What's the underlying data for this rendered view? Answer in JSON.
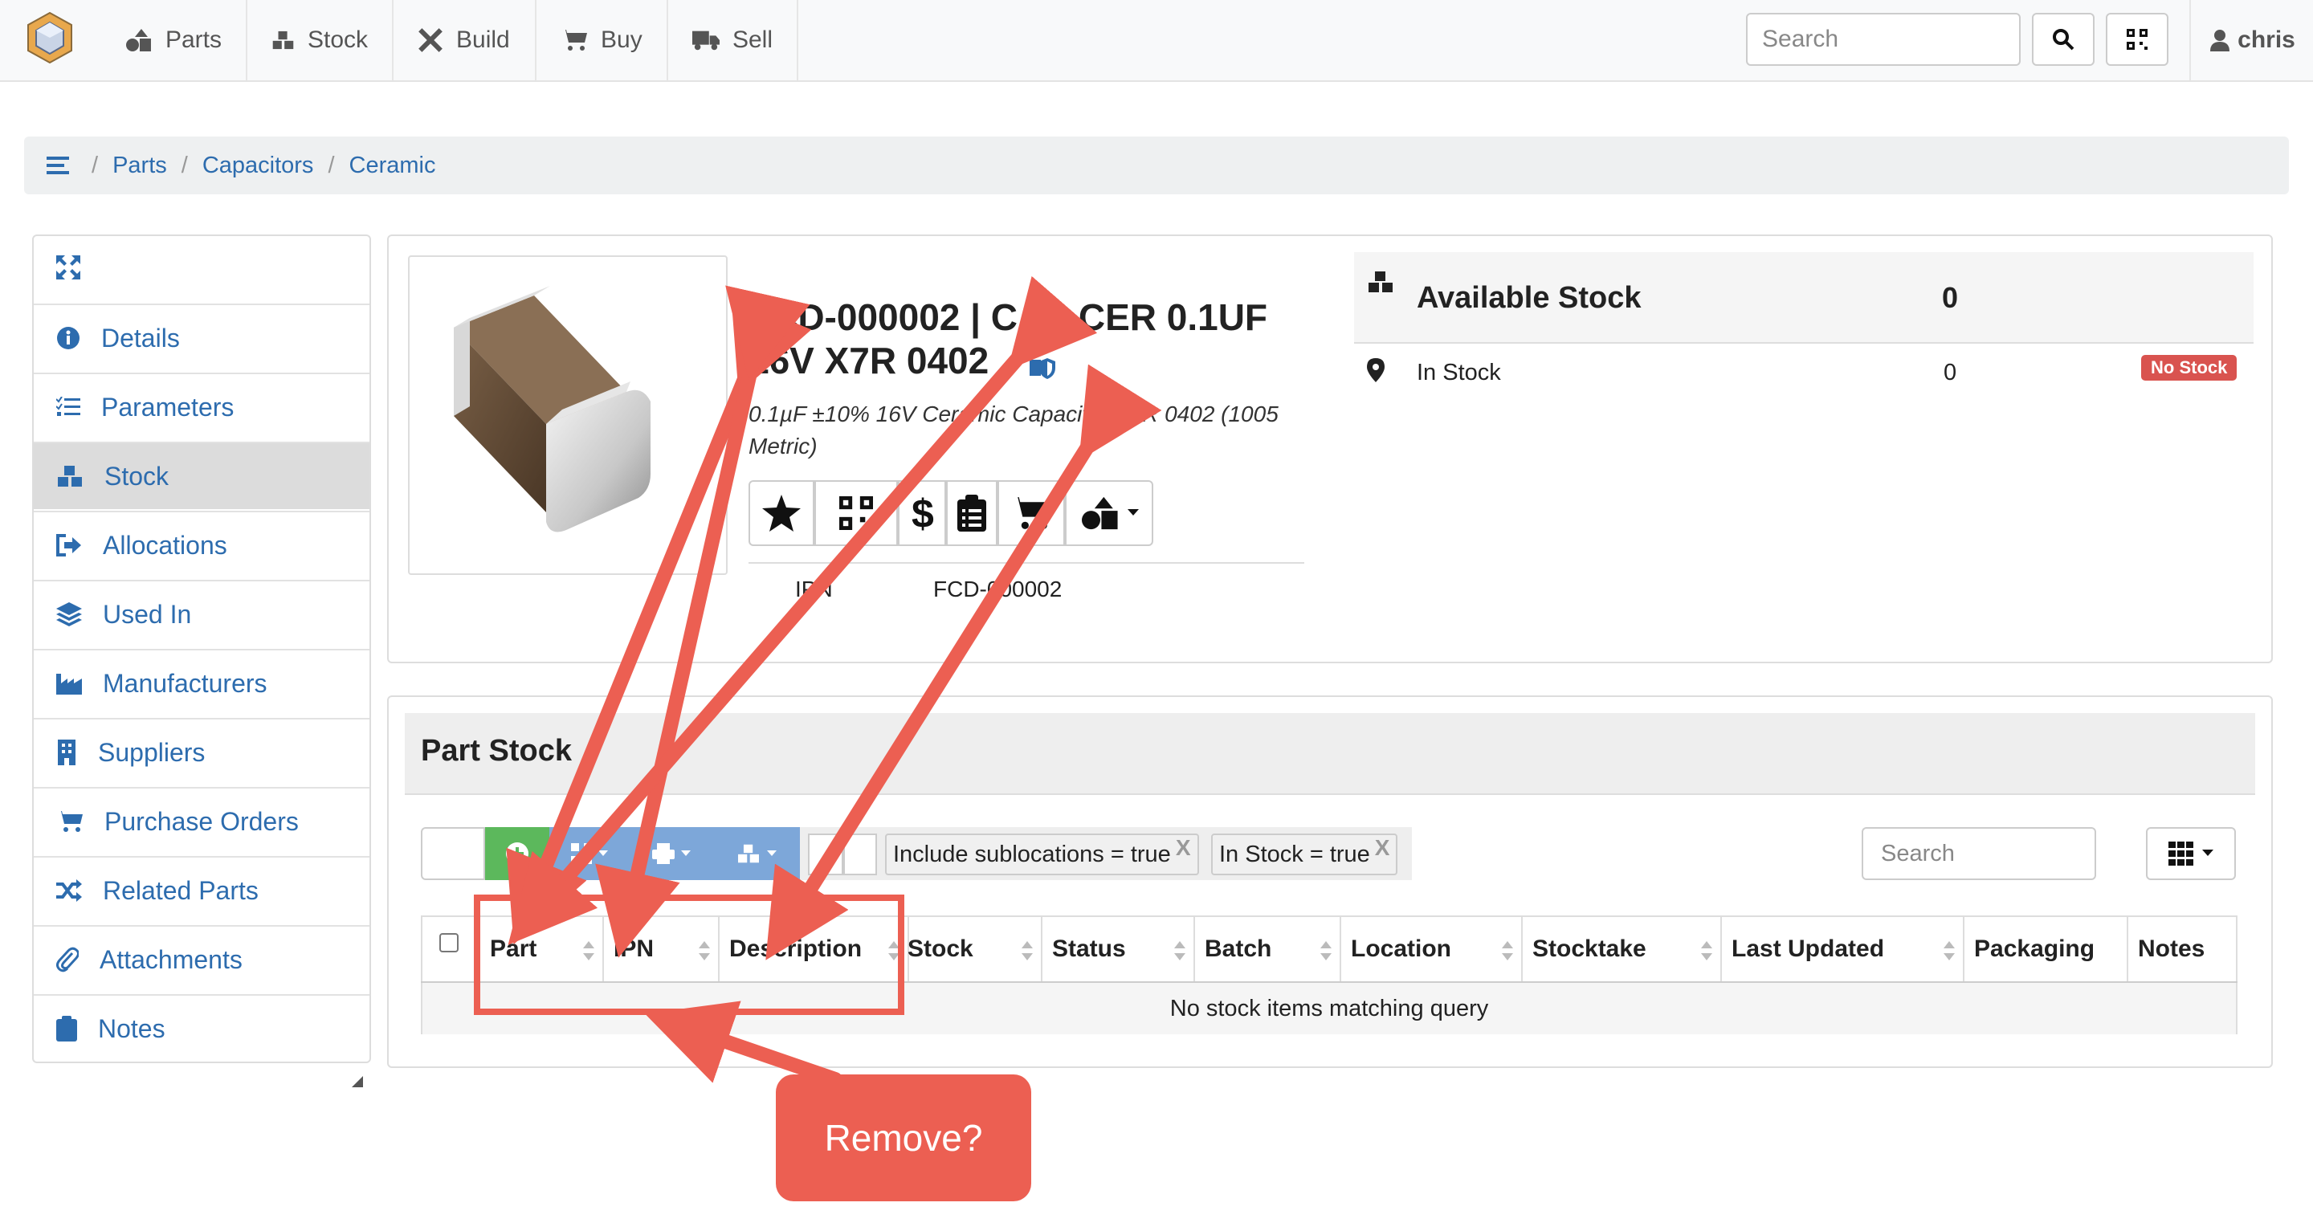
{
  "navbar": {
    "items": [
      {
        "label": "Parts",
        "icon": "shapes-icon"
      },
      {
        "label": "Stock",
        "icon": "boxes-icon"
      },
      {
        "label": "Build",
        "icon": "tools-icon"
      },
      {
        "label": "Buy",
        "icon": "cart-icon"
      },
      {
        "label": "Sell",
        "icon": "truck-icon"
      }
    ],
    "search_placeholder": "Search",
    "user": "chris"
  },
  "breadcrumb": [
    "Parts",
    "Capacitors",
    "Ceramic"
  ],
  "sidebar": {
    "items": [
      {
        "label": "Details",
        "icon": "info-icon"
      },
      {
        "label": "Parameters",
        "icon": "list-check-icon"
      },
      {
        "label": "Stock",
        "icon": "boxes-icon",
        "active": true
      },
      {
        "label": "Allocations",
        "icon": "sign-out-icon"
      },
      {
        "label": "Used In",
        "icon": "layers-icon"
      },
      {
        "label": "Manufacturers",
        "icon": "industry-icon"
      },
      {
        "label": "Suppliers",
        "icon": "building-icon"
      },
      {
        "label": "Purchase Orders",
        "icon": "cart-icon"
      },
      {
        "label": "Related Parts",
        "icon": "random-icon"
      },
      {
        "label": "Attachments",
        "icon": "paperclip-icon"
      },
      {
        "label": "Notes",
        "icon": "clipboard-icon"
      }
    ]
  },
  "part": {
    "title_line1": "FCD-000002 | CAP CER 0.1UF",
    "title_line2": "16V X7R 0402",
    "description_line1": "0.1µF ±10% 16V Ceramic Capacitor X7R 0402 (1005",
    "description_line2": "Metric)",
    "ipn_label": "IPN",
    "ipn_value": "FCD-000002"
  },
  "stock_summary": {
    "available_label": "Available Stock",
    "available_value": "0",
    "in_stock_label": "In Stock",
    "in_stock_value": "0",
    "badge": "No Stock",
    "badge_color": "#d9534f"
  },
  "part_stock": {
    "title": "Part Stock",
    "filters": [
      {
        "label": "Include sublocations = true",
        "close": "X"
      },
      {
        "label": "In Stock = true",
        "close": "X"
      }
    ],
    "search_placeholder": "Search",
    "columns": [
      "Part",
      "IPN",
      "Description",
      "Stock",
      "Status",
      "Batch",
      "Location",
      "Stocktake",
      "Last Updated",
      "Packaging",
      "Notes"
    ],
    "empty_message": "No stock items matching query"
  },
  "annotation": {
    "callout": "Remove?",
    "color": "#ec5f52"
  }
}
